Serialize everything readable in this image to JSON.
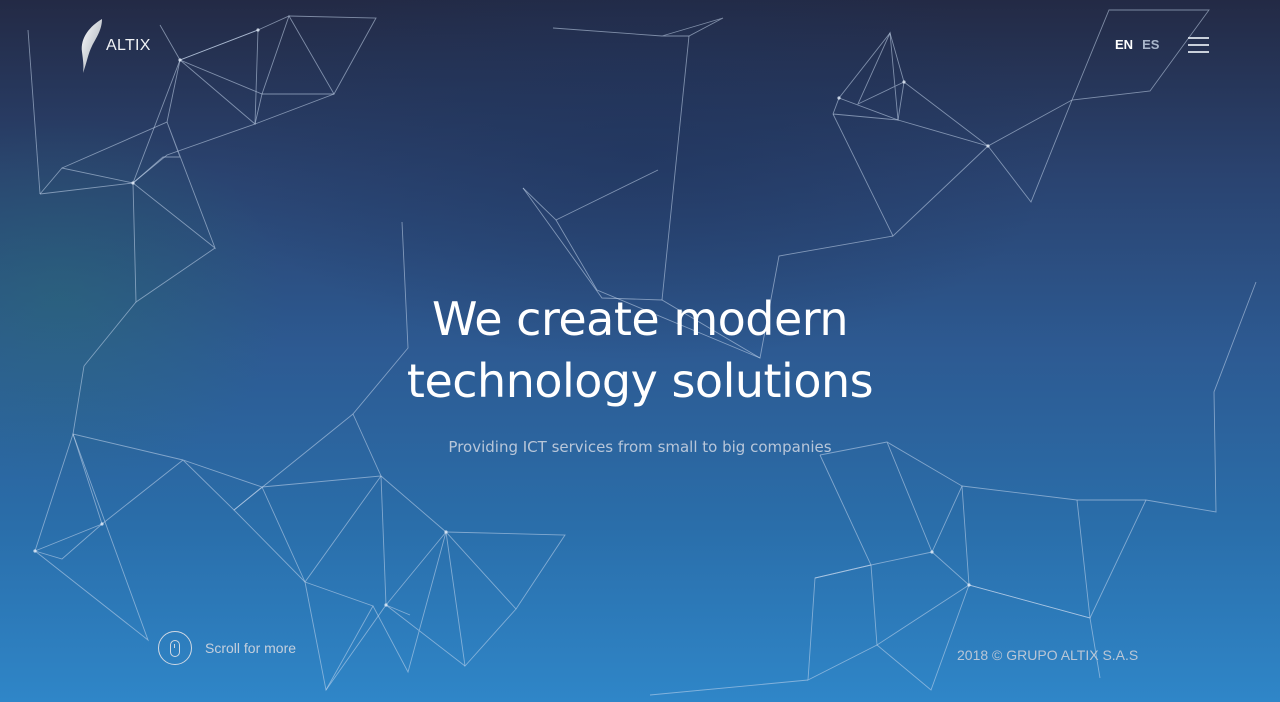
{
  "brand": {
    "name": "ALTIX"
  },
  "header": {
    "languages": [
      {
        "code": "EN",
        "active": true
      },
      {
        "code": "ES",
        "active": false
      }
    ],
    "menu_icon": "hamburger-menu-icon"
  },
  "hero": {
    "title_line1": "We create modern",
    "title_line2": "technology solutions",
    "subtitle": "Providing ICT services from small to big companies"
  },
  "scroll": {
    "label": "Scroll for more",
    "icon": "mouse-icon"
  },
  "footer": {
    "copyright": "2018 © GRUPO ALTIX S.A.S"
  },
  "colors": {
    "bg_top": "#232a45",
    "bg_bottom": "#2f86c8",
    "text_primary": "#ffffff",
    "text_muted": "#b8c6d9"
  }
}
